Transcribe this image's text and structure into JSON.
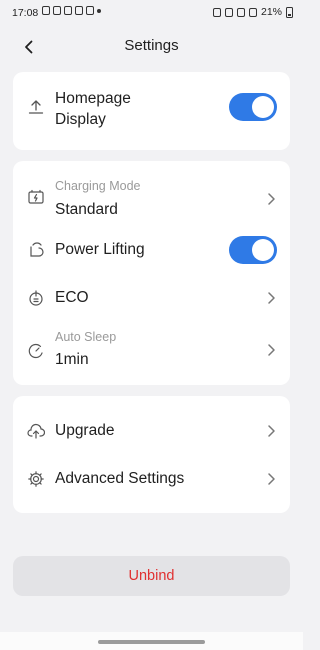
{
  "status_bar": {
    "time": "17:08",
    "battery": "21%"
  },
  "header": {
    "title": "Settings"
  },
  "card1": {
    "homepage_display": {
      "label_line1": "Homepage",
      "label_line2": "Display",
      "toggle_on": true,
      "icon": "upload-icon"
    }
  },
  "card2": {
    "charging_mode": {
      "label": "Charging Mode",
      "value": "Standard",
      "icon": "battery-charge-icon"
    },
    "power_lifting": {
      "label": "Power Lifting",
      "toggle_on": true,
      "icon": "power-lift-icon"
    },
    "eco": {
      "label": "ECO",
      "icon": "eco-icon"
    },
    "auto_sleep": {
      "label": "Auto Sleep",
      "value": "1min",
      "icon": "sleep-icon"
    }
  },
  "card3": {
    "upgrade": {
      "label": "Upgrade",
      "icon": "cloud-upload-icon"
    },
    "advanced_settings": {
      "label": "Advanced Settings",
      "icon": "gear-icon"
    }
  },
  "unbind": {
    "label": "Unbind"
  },
  "colors": {
    "accent": "#2f7ae6",
    "danger": "#e03131",
    "background": "#f2f2f4"
  }
}
